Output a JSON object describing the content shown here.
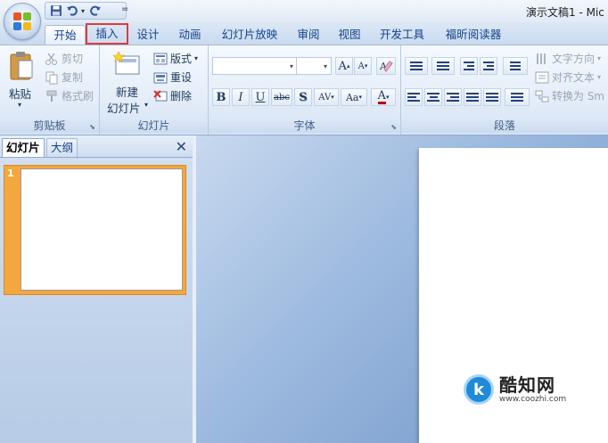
{
  "window": {
    "title": "演示文稿1 - Mic"
  },
  "qat": {
    "icons": [
      "save-icon",
      "undo-icon",
      "redo-icon"
    ],
    "more_glyph": "="
  },
  "tabs": [
    {
      "label": "开始",
      "state": "active"
    },
    {
      "label": "插入",
      "state": "highlighted"
    },
    {
      "label": "设计"
    },
    {
      "label": "动画"
    },
    {
      "label": "幻灯片放映"
    },
    {
      "label": "审阅"
    },
    {
      "label": "视图"
    },
    {
      "label": "开发工具"
    },
    {
      "label": "福昕阅读器"
    }
  ],
  "clipboard": {
    "label": "剪贴板",
    "paste": "粘贴",
    "cut": "剪切",
    "copy": "复制",
    "format_painter": "格式刷"
  },
  "slides_group": {
    "label": "幻灯片",
    "new_slide_line1": "新建",
    "new_slide_line2": "幻灯片",
    "layout": "版式",
    "reset": "重设",
    "delete": "删除"
  },
  "font": {
    "label": "字体",
    "name_value": "",
    "size_value": "",
    "bold": "B",
    "italic": "I",
    "underline": "U",
    "strike": "abc",
    "shadow": "S",
    "spacing": "AV",
    "case": "Aa",
    "color": "A",
    "grow": "A",
    "shrink": "A"
  },
  "paragraph": {
    "label": "段落",
    "text_direction": "文字方向",
    "align_text": "对齐文本",
    "convert_smartart": "转换为 Sm"
  },
  "left_pane": {
    "tab_slides": "幻灯片",
    "tab_outline": "大纲",
    "close_glyph": "✕",
    "thumb_number": "1"
  },
  "watermark": {
    "glyph": "k",
    "name": "酷知网",
    "url": "www.coozhi.com"
  },
  "colors": {
    "highlight": "#e03a3a",
    "thumb_selected": "#f5a73f",
    "tab_text": "#15428b"
  }
}
